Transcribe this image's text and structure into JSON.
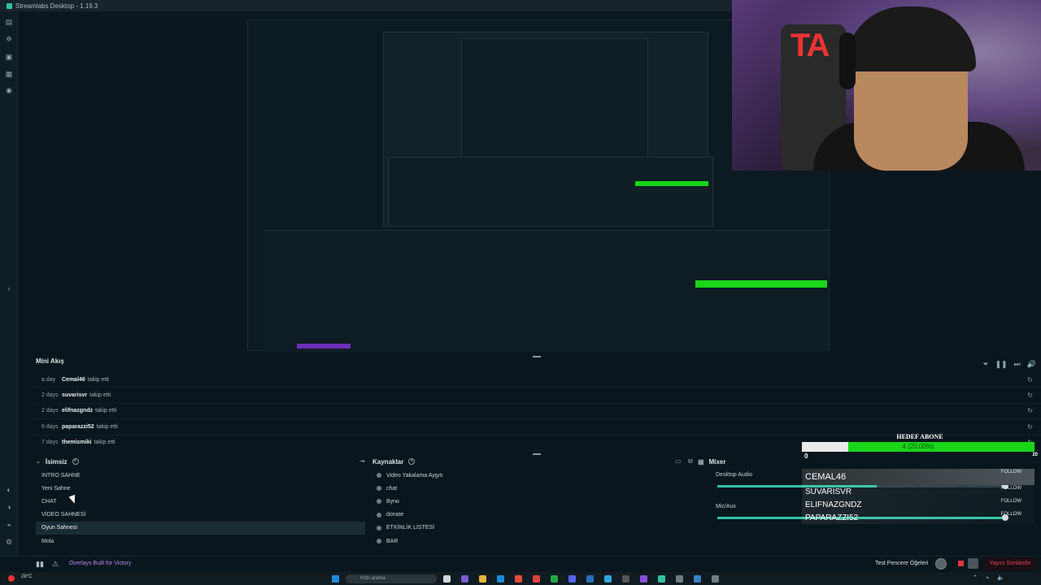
{
  "window": {
    "title": "Streamlabs Desktop - 1.19.3"
  },
  "mini_feed": {
    "title": "Mini Akış",
    "rows": [
      {
        "ago": "a day",
        "user": "Cemal46",
        "action": "takip etti"
      },
      {
        "ago": "2 days",
        "user": "suvarisvr",
        "action": "takip etti"
      },
      {
        "ago": "2 days",
        "user": "elifnazgndz",
        "action": "takip etti"
      },
      {
        "ago": "6 days",
        "user": "paparazzi52",
        "action": "takip etti"
      },
      {
        "ago": "7 days",
        "user": "themismiki",
        "action": "takip etti"
      }
    ]
  },
  "scenes": {
    "title": "İsimsiz",
    "items": [
      "INTRO SAHNE",
      "Yeni Sahne",
      "CHAT",
      "VİDEO SAHNESİ",
      "Oyun Sahnesi",
      "Mola"
    ],
    "selected_index": 4
  },
  "sources": {
    "title": "Kaynaklar",
    "items": [
      "Video Yakalama Aygıtı",
      "chat",
      "Byno",
      "donate",
      "ETKİNLİK LİSTESİ",
      "BAR"
    ]
  },
  "mixer": {
    "title": "Mixer",
    "channels": [
      {
        "name": "Desktop Audio",
        "level": 0.55
      },
      {
        "name": "Mic/Aux",
        "level": 1.0
      }
    ]
  },
  "goal_widget": {
    "title": "HEDEF ABONE",
    "progress_label": "4 (20.00%)",
    "progress": 0.2,
    "min": "0",
    "max": "20"
  },
  "followers": [
    {
      "name": "CEMAL46",
      "tag": "FOLLOW"
    },
    {
      "name": "SUVARISVR",
      "tag": "FOLLOW"
    },
    {
      "name": "ELIFNAZGNDZ",
      "tag": "FOLLOW"
    },
    {
      "name": "PAPARAZZI52",
      "tag": "FOLLOW"
    }
  ],
  "statusbar": {
    "overlay_link": "Overlays Built for Victory",
    "test_label": "Test Pencere Öğeleri",
    "stop_label": "Yayını Sonlandır"
  },
  "taskbar": {
    "weather": "28°C",
    "search_placeholder": "Hızlı arama"
  },
  "colors": {
    "accent": "#31c3a2",
    "goal_fill": "#19d619",
    "overlay_link": "#b58cf7",
    "stop": "#ef3d5a"
  }
}
